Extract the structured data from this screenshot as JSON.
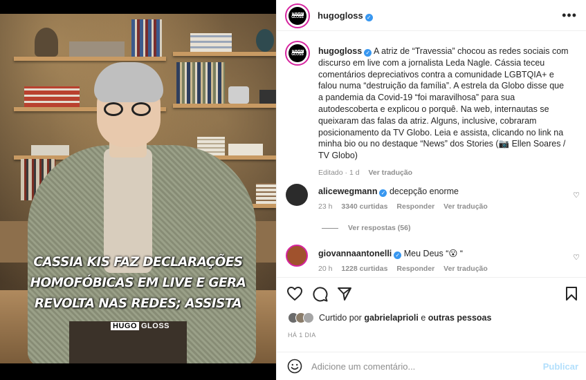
{
  "post": {
    "headline": "CASSIA KIS FAZ DECLARAÇÕES HOMOFÓBICAS EM LIVE E GERA REVOLTA NAS REDES; ASSISTA",
    "watermark_a": "HUGO",
    "watermark_b": "GLOSS",
    "logo_top": "HUGO",
    "logo_bottom": "GLOSS"
  },
  "header": {
    "username": "hugogloss",
    "more_label": "•••"
  },
  "caption": {
    "username": "hugogloss",
    "text": "A atriz de “Travessia” chocou as redes sociais com discurso em live com a jornalista Leda Nagle. Cássia teceu comentários depreciativos contra a comunidade LGBTQIA+ e falou numa “destruição da família”. A estrela da Globo disse que a pandemia da Covid-19 “foi maravilhosa” para sua autodescoberta e explicou o porquê. Na web, internautas se queixaram das falas da atriz. Alguns, inclusive, cobraram posicionamento da TV Globo. Leia e assista, clicando no link na minha bio ou no destaque “News” dos Stories (📷 Ellen Soares / TV Globo)",
    "edited": "Editado · 1 d",
    "translate": "Ver tradução"
  },
  "comments": [
    {
      "username": "alicewegmann",
      "text": "decepção enorme",
      "time": "23 h",
      "likes": "3340 curtidas",
      "reply": "Responder",
      "translate": "Ver tradução",
      "avatar_color": "#2b2b2b"
    },
    {
      "username": "giovannaantonelli",
      "text": "Meu Deus “😮 “",
      "time": "20 h",
      "likes": "1228 curtidas",
      "reply": "Responder",
      "translate": "Ver tradução",
      "avatar_color": "#a0522d"
    }
  ],
  "replies_link": "Ver respostas (56)",
  "likes": {
    "prefix": "Curtido por",
    "user": "gabrielaprioli",
    "suffix": "e outras pessoas"
  },
  "date": "HÁ 1 DIA",
  "add_comment": {
    "placeholder": "Adicione um comentário...",
    "post_label": "Publicar"
  },
  "colors": {
    "verified": "#3897f0",
    "ring": "#d6249f",
    "muted": "#8e8e8e",
    "post_disabled": "#b2dffc"
  }
}
